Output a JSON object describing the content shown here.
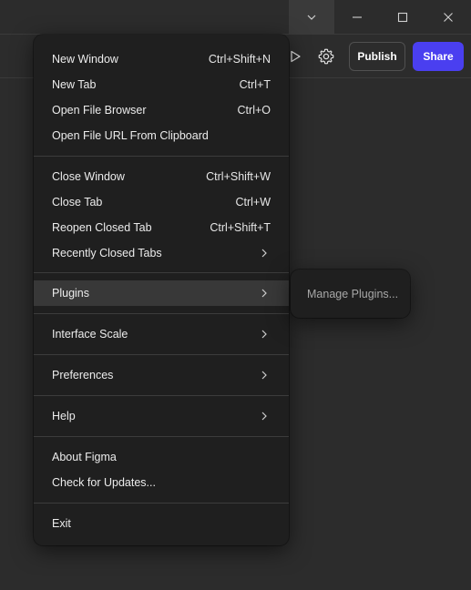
{
  "titlebar": {
    "icons": [
      "chevron-down-icon",
      "minimize-icon",
      "maximize-icon",
      "close-icon"
    ]
  },
  "toolbar": {
    "publish_label": "Publish",
    "share_label": "Share",
    "share_color": "#4a3ff0",
    "icons": [
      "play-icon",
      "gear-icon"
    ]
  },
  "menu": {
    "items": [
      {
        "label": "New Window",
        "shortcut": "Ctrl+Shift+N"
      },
      {
        "label": "New Tab",
        "shortcut": "Ctrl+T"
      },
      {
        "label": "Open File Browser",
        "shortcut": "Ctrl+O"
      },
      {
        "label": "Open File URL From Clipboard",
        "shortcut": ""
      },
      {
        "label": "Close Window",
        "shortcut": "Ctrl+Shift+W"
      },
      {
        "label": "Close Tab",
        "shortcut": "Ctrl+W"
      },
      {
        "label": "Reopen Closed Tab",
        "shortcut": "Ctrl+Shift+T"
      },
      {
        "label": "Recently Closed Tabs",
        "shortcut": ""
      },
      {
        "label": "Plugins",
        "shortcut": ""
      },
      {
        "label": "Interface Scale",
        "shortcut": ""
      },
      {
        "label": "Preferences",
        "shortcut": ""
      },
      {
        "label": "Help",
        "shortcut": ""
      },
      {
        "label": "About Figma",
        "shortcut": ""
      },
      {
        "label": "Check for Updates...",
        "shortcut": ""
      },
      {
        "label": "Exit",
        "shortcut": ""
      }
    ],
    "active_item": "Plugins"
  },
  "submenu": {
    "items": [
      {
        "label": "Manage Plugins..."
      }
    ]
  }
}
